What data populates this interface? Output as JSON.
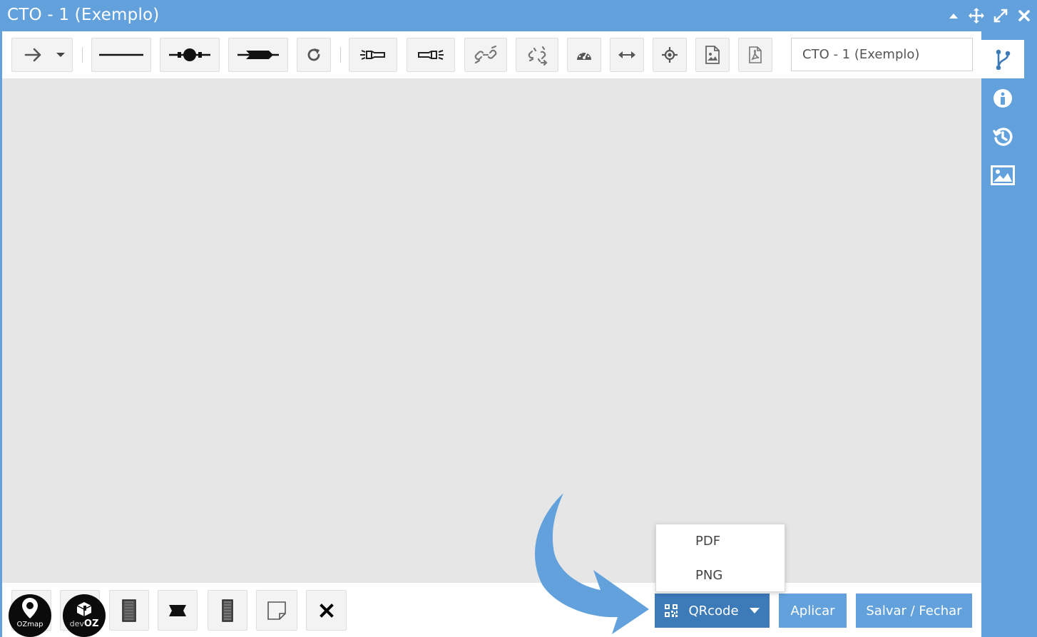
{
  "window": {
    "title": "CTO - 1 (Exemplo)",
    "accent_color": "#62a1dc",
    "controls": [
      "collapse-icon",
      "move-icon",
      "expand-icon",
      "close-icon"
    ]
  },
  "toolbar": {
    "name_value": "CTO - 1 (Exemplo)",
    "tools": [
      "arrow-select-icon",
      "line-icon",
      "connector-round-icon",
      "connector-square-icon",
      "redo-icon",
      "light-source-icon",
      "light-meter-icon",
      "link-icon",
      "unlink-icon",
      "gauge-icon",
      "resize-horizontal-icon",
      "crosshair-icon",
      "image-export-icon",
      "pdf-export-icon"
    ]
  },
  "sidebar": {
    "tabs": [
      "fiber-branch-icon",
      "info-icon",
      "history-icon",
      "image-icon"
    ]
  },
  "bottombar": {
    "logos": {
      "ozmap": "OZmap",
      "devoz_prefix": "dev",
      "devoz_suffix": "OZ"
    },
    "qrcode_label": "QRcode",
    "apply_label": "Aplicar",
    "save_close_label": "Salvar / Fechar",
    "button_color": "#62a1dc",
    "button_active_color": "#3c7ab8"
  },
  "qrcode_menu": {
    "items": [
      {
        "label": "PDF"
      },
      {
        "label": "PNG"
      }
    ]
  }
}
